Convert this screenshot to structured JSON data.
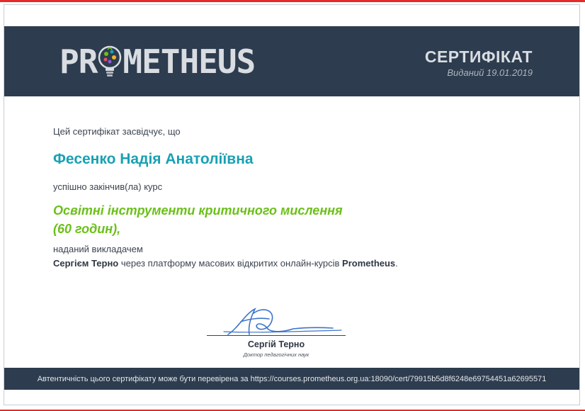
{
  "header": {
    "logo_text_left": "PR",
    "logo_text_right": "METHEUS",
    "title": "СЕРТИФІКАТ",
    "issued": "Виданий 19.01.2019"
  },
  "body": {
    "intro": "Цей сертифікат засвідчує, що",
    "recipient": "Фесенко Надія Анатоліївна",
    "completed": "успішно закінчив(ла) курс",
    "course_line1": "Освітні інструменти критичного мислення",
    "course_line2": "(60 годин),",
    "provided_by": "наданий викладачем",
    "instructor": "Сергієм Терно",
    "platform_text": " через платформу масових відкритих онлайн-курсів ",
    "platform": "Prometheus",
    "end": "."
  },
  "signature": {
    "name": "Сергій Терно",
    "title": "Доктор педагогічних наук"
  },
  "footer": {
    "text": "Автентичність цього сертифікату може бути перевірена за https://courses.prometheus.org.ua:18090/cert/79915b5d8f6248e69754451a62695571"
  },
  "colors": {
    "header_bg": "#2d3c4e",
    "recipient": "#19a1b3",
    "course": "#6bc01a"
  }
}
